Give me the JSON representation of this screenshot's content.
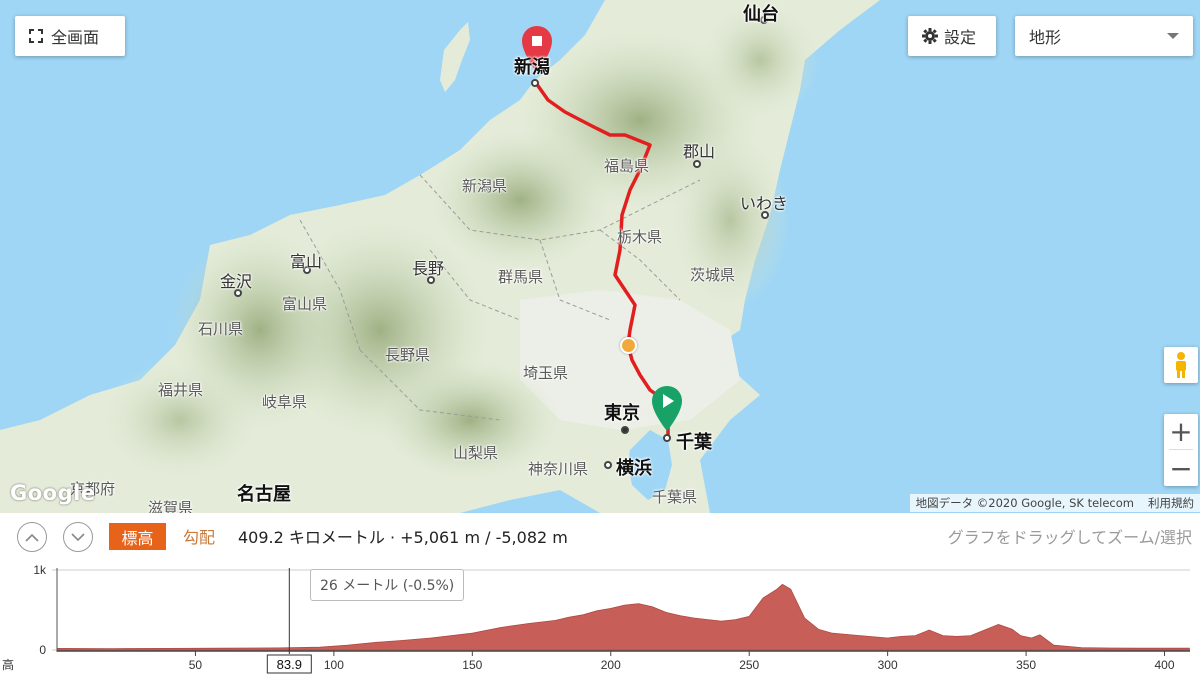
{
  "map": {
    "fullscreen_label": "全画面",
    "settings_label": "設定",
    "maptype_value": "地形",
    "logo": "Google",
    "attribution": "地図データ ©2020 Google, SK telecom",
    "terms": "利用規約",
    "places": {
      "sendai": "仙台",
      "niigata_city": "新潟",
      "koriyama": "郡山",
      "fukushima": "福島県",
      "iwaki": "いわき",
      "niigata_pref": "新潟県",
      "tochigi": "栃木県",
      "toyama_city": "富山",
      "nagano_city": "長野",
      "gunma": "群馬県",
      "ibaraki": "茨城県",
      "kanazawa": "金沢",
      "toyama_pref": "富山県",
      "ishikawa": "石川県",
      "nagano_pref": "長野県",
      "saitama": "埼玉県",
      "fukui": "福井県",
      "gifu": "岐阜県",
      "tokyo": "東京",
      "chiba_city": "千葉",
      "yamanashi": "山梨県",
      "kanagawa": "神奈川県",
      "yokohama": "横浜",
      "kyoto": "京都府",
      "shiga": "滋賀県",
      "nagoya": "名古屋",
      "chiba_pref": "千葉県"
    },
    "colors": {
      "route": "#e11f1f",
      "start": "#18a267",
      "end": "#e63946",
      "cursor": "#f2a93b",
      "sea": "#9fd6f5"
    }
  },
  "panel": {
    "tab_elevation": "標高",
    "tab_grade": "勾配",
    "summary": "409.2 キロメートル · +5,061 m / -5,082 m",
    "hint": "グラフをドラッグしてズーム/選択",
    "tooltip": "26 メートル (-0.5%)",
    "cursor_label": "83.9",
    "axis_label": "高"
  },
  "chart_data": {
    "type": "area",
    "y_ticks": [
      "1k",
      "0"
    ],
    "x_ticks": [
      "50",
      "100",
      "150",
      "200",
      "250",
      "300",
      "350",
      "400"
    ],
    "xlim": [
      0,
      409.2
    ],
    "ylim": [
      0,
      1000
    ],
    "cursor_x": 83.9,
    "color": "#c85e58",
    "x": [
      0,
      20,
      40,
      60,
      80,
      95,
      105,
      115,
      125,
      135,
      145,
      150,
      160,
      170,
      175,
      180,
      185,
      190,
      195,
      200,
      205,
      210,
      215,
      220,
      225,
      230,
      235,
      240,
      245,
      250,
      255,
      260,
      262,
      265,
      270,
      275,
      280,
      290,
      300,
      305,
      310,
      315,
      320,
      325,
      330,
      335,
      340,
      345,
      348,
      352,
      355,
      360,
      370,
      380,
      390,
      409
    ],
    "y": [
      20,
      18,
      20,
      22,
      26,
      35,
      60,
      95,
      120,
      150,
      190,
      210,
      280,
      330,
      350,
      370,
      410,
      440,
      490,
      520,
      560,
      580,
      540,
      470,
      430,
      400,
      380,
      360,
      380,
      420,
      650,
      760,
      820,
      760,
      400,
      260,
      210,
      180,
      150,
      170,
      180,
      250,
      180,
      170,
      180,
      250,
      320,
      260,
      180,
      150,
      190,
      60,
      30,
      25,
      22,
      22
    ]
  }
}
